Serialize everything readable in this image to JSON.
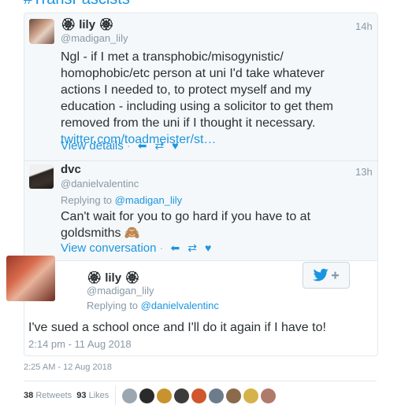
{
  "header_clip": "#TransFascists",
  "tweets": [
    {
      "name": "🏵 lily 🏵",
      "handle": "@madigan_lily",
      "time": "14h",
      "text_lines": [
        "Ngl - if I met a transphobic/misogynistic/",
        "homophobic/etc person at uni I'd take whatever",
        "actions I needed to, to protect myself and my",
        "education - including using a solicitor to get them",
        "removed from the uni if I thought it necessary."
      ],
      "link": "twitter.com/toadmeister/st…",
      "action_label": "View details"
    },
    {
      "name": "dvc",
      "handle": "@danielvalentinc",
      "time": "13h",
      "reply_prefix": "Replying to",
      "reply_to": "@madigan_lily",
      "text_lines": [
        "Can't wait for you to go hard if you have to at",
        "goldsmiths 🙈"
      ],
      "action_label": "View conversation"
    }
  ],
  "main_tweet": {
    "name": "🏵 lily 🏵",
    "handle": "@madigan_lily",
    "reply_prefix": "Replying to",
    "reply_to": "@danielvalentinc",
    "text": "I've sued a school once and I'll do it again if I have to!",
    "timestamp": "2:14 pm - 11 Aug 2018",
    "follow_icon": "twitter-bird-plus-icon"
  },
  "footer": {
    "date": "2:25 AM - 12 Aug 2018",
    "retweets_count": "38",
    "retweets_label": "Retweets",
    "likes_count": "93",
    "likes_label": "Likes"
  },
  "colors": {
    "accent": "#1b95e0",
    "muted": "#8899a6",
    "text": "#292f33"
  }
}
